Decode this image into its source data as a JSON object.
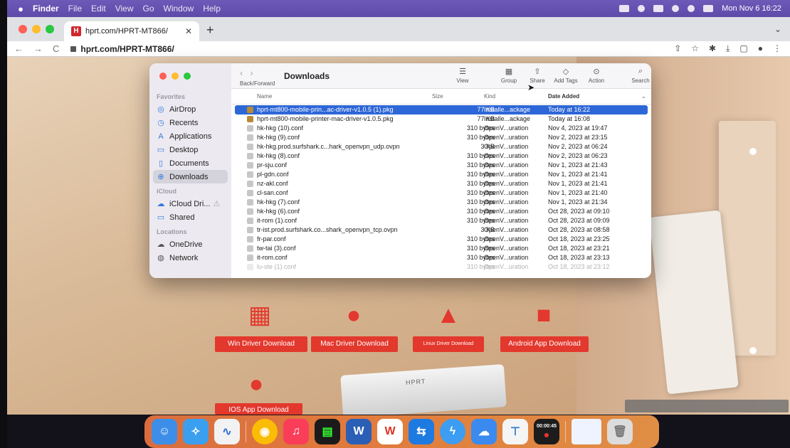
{
  "menubar": {
    "apple": "",
    "app": "Finder",
    "menus": [
      "File",
      "Edit",
      "View",
      "Go",
      "Window",
      "Help"
    ],
    "datetime": "Mon Nov 6  16:22"
  },
  "browser": {
    "tab_title": "hprt.com/HPRT-MT866/",
    "favicon": "H",
    "url": "hprt.com/HPRT-MT866/"
  },
  "finder": {
    "title": "Downloads",
    "back_forward_label": "Back/Forward",
    "toolbar": [
      {
        "icon": "view-icon",
        "label": "View"
      },
      {
        "icon": "group-icon",
        "label": "Group"
      },
      {
        "icon": "share-icon",
        "label": "Share"
      },
      {
        "icon": "tag-icon",
        "label": "Add Tags"
      },
      {
        "icon": "action-icon",
        "label": "Action"
      },
      {
        "icon": "search-icon",
        "label": "Search"
      }
    ],
    "sidebar": {
      "favorites_label": "Favorites",
      "favorites": [
        "AirDrop",
        "Recents",
        "Applications",
        "Desktop",
        "Documents",
        "Downloads"
      ],
      "icloud_label": "iCloud",
      "icloud": [
        "iCloud Dri...",
        "Shared"
      ],
      "locations_label": "Locations",
      "locations": [
        "OneDrive",
        "Network"
      ]
    },
    "columns": {
      "name": "Name",
      "size": "Size",
      "kind": "Kind",
      "date": "Date Added"
    },
    "files": [
      {
        "name": "hprt-mt800-mobile-prin...ac-driver-v1.0.5 (1).pkg",
        "size": "77 KB",
        "kind": "Installe...ackage",
        "date": "Today at 16:22"
      },
      {
        "name": "hprt-mt800-mobile-printer-mac-driver-v1.0.5.pkg",
        "size": "77 KB",
        "kind": "Installe...ackage",
        "date": "Today at 16:08"
      },
      {
        "name": "hk-hkg (10).conf",
        "size": "310 bytes",
        "kind": "OpenV...uration",
        "date": "Nov 4, 2023 at 19:47"
      },
      {
        "name": "hk-hkg (9).conf",
        "size": "310 bytes",
        "kind": "OpenV...uration",
        "date": "Nov 2, 2023 at 23:15"
      },
      {
        "name": "hk-hkg.prod.surfshark.c...hark_openvpn_udp.ovpn",
        "size": "3 KB",
        "kind": "OpenV...uration",
        "date": "Nov 2, 2023 at 06:24"
      },
      {
        "name": "hk-hkg (8).conf",
        "size": "310 bytes",
        "kind": "OpenV...uration",
        "date": "Nov 2, 2023 at 06:23"
      },
      {
        "name": "pr-sju.conf",
        "size": "310 bytes",
        "kind": "OpenV...uration",
        "date": "Nov 1, 2023 at 21:43"
      },
      {
        "name": "pl-gdn.conf",
        "size": "310 bytes",
        "kind": "OpenV...uration",
        "date": "Nov 1, 2023 at 21:41"
      },
      {
        "name": "nz-akl.conf",
        "size": "310 bytes",
        "kind": "OpenV...uration",
        "date": "Nov 1, 2023 at 21:41"
      },
      {
        "name": "cl-san.conf",
        "size": "310 bytes",
        "kind": "OpenV...uration",
        "date": "Nov 1, 2023 at 21:40"
      },
      {
        "name": "hk-hkg (7).conf",
        "size": "310 bytes",
        "kind": "OpenV...uration",
        "date": "Nov 1, 2023 at 21:34"
      },
      {
        "name": "hk-hkg (6).conf",
        "size": "310 bytes",
        "kind": "OpenV...uration",
        "date": "Oct 28, 2023 at 09:10"
      },
      {
        "name": "it-rom (1).conf",
        "size": "310 bytes",
        "kind": "OpenV...uration",
        "date": "Oct 28, 2023 at 09:09"
      },
      {
        "name": "tr-ist.prod.surfshark.co...shark_openvpn_tcp.ovpn",
        "size": "3 KB",
        "kind": "OpenV...uration",
        "date": "Oct 28, 2023 at 08:58"
      },
      {
        "name": "fr-par.conf",
        "size": "310 bytes",
        "kind": "OpenV...uration",
        "date": "Oct 18, 2023 at 23:25"
      },
      {
        "name": "tw-tai (3).conf",
        "size": "310 bytes",
        "kind": "OpenV...uration",
        "date": "Oct 18, 2023 at 23:21"
      },
      {
        "name": "it-rom.conf",
        "size": "310 bytes",
        "kind": "OpenV...uration",
        "date": "Oct 18, 2023 at 23:13"
      },
      {
        "name": "lu-ste (1).conf",
        "size": "310 bytes",
        "kind": "OpenV...uration",
        "date": "Oct 18, 2023 at 23:12"
      }
    ]
  },
  "webpage": {
    "downloads": [
      {
        "label": "Win Driver Download",
        "icon": "windows-icon"
      },
      {
        "label": "Mac Driver Download",
        "icon": "appstore-icon"
      },
      {
        "label": "Linux Driver Download",
        "icon": "linux-icon"
      },
      {
        "label": "Android App Download",
        "icon": "android-icon"
      },
      {
        "label": "IOS App Download",
        "icon": "apple-icon"
      }
    ],
    "printer_brand": "HPRT",
    "accent": "#e3382d"
  },
  "dock": {
    "recording_time": "00:00:45"
  }
}
